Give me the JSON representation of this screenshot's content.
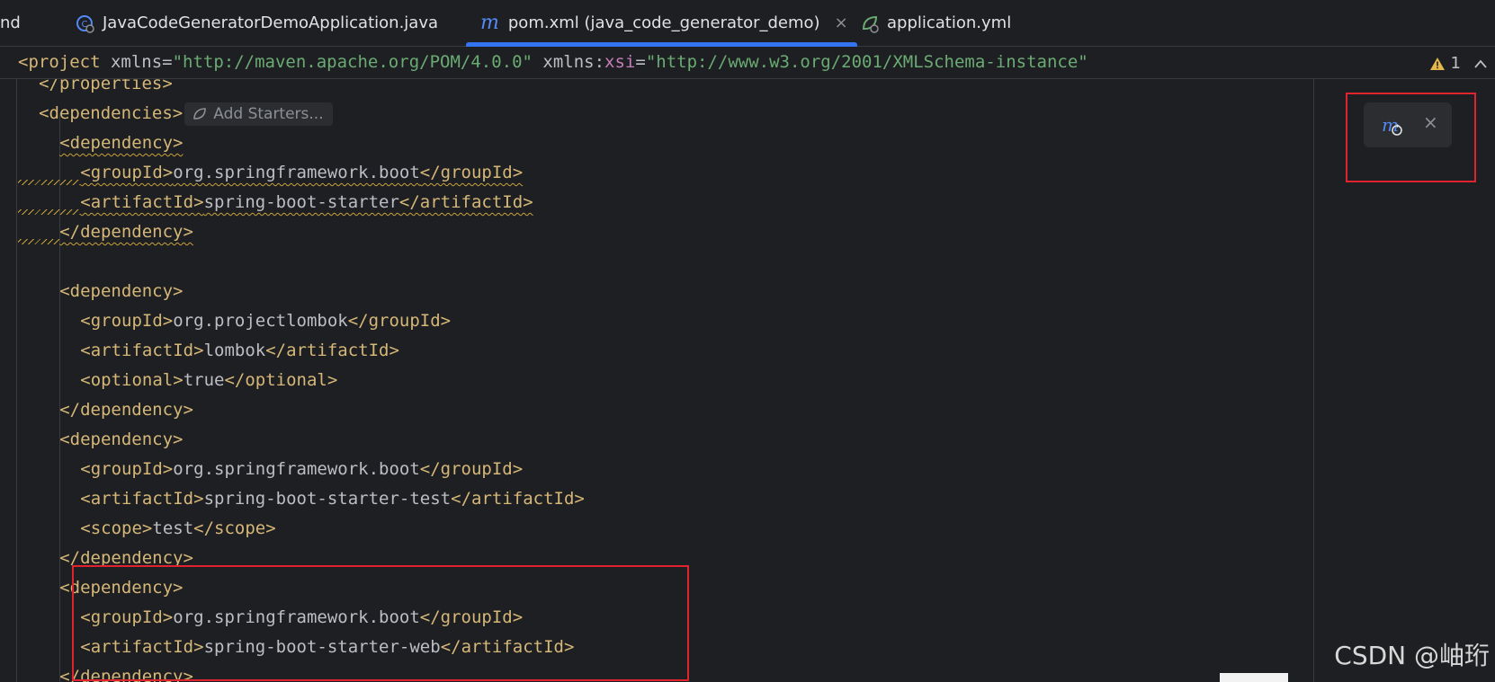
{
  "tabs": [
    {
      "label": "nd"
    },
    {
      "label": "JavaCodeGeneratorDemoApplication.java"
    },
    {
      "label": "pom.xml (java_code_generator_demo)",
      "icon": "m",
      "close": "×"
    },
    {
      "label": "application.yml"
    }
  ],
  "header": {
    "tag_open": "<project",
    "attr1": " xmlns=",
    "val1": "\"http://maven.apache.org/POM/4.0.0\"",
    "attr2_a": " xmlns:",
    "attr2_ns": "xsi",
    "attr2_eq": "=",
    "val2": "\"http://www.w3.org/2001/XMLSchema-instance\"",
    "warning_count": "1"
  },
  "starter_chip": "Add Starters...",
  "code_lines": [
    {
      "indent": 2,
      "tag1": "</properties>",
      "partial": true
    },
    {
      "indent": 2,
      "tag1": "<dependencies>",
      "chip": true
    },
    {
      "indent": 4,
      "tag1": "<dependency>",
      "squig": true
    },
    {
      "indent": 6,
      "tag1": "<groupId>",
      "text": "org.springframework.boot",
      "tag2": "</groupId>",
      "squig": true,
      "lead": true
    },
    {
      "indent": 6,
      "tag1": "<artifactId>",
      "text": "spring-boot-starter",
      "tag2": "</artifactId>",
      "squig": true,
      "lead": true
    },
    {
      "indent": 4,
      "tag1": "</dependency>",
      "squig": true,
      "lead": true
    },
    {
      "indent": 0,
      "tag1": ""
    },
    {
      "indent": 4,
      "tag1": "<dependency>"
    },
    {
      "indent": 6,
      "tag1": "<groupId>",
      "text": "org.projectlombok",
      "tag2": "</groupId>"
    },
    {
      "indent": 6,
      "tag1": "<artifactId>",
      "text": "lombok",
      "tag2": "</artifactId>"
    },
    {
      "indent": 6,
      "tag1": "<optional>",
      "text": "true",
      "tag2": "</optional>"
    },
    {
      "indent": 4,
      "tag1": "</dependency>"
    },
    {
      "indent": 4,
      "tag1": "<dependency>"
    },
    {
      "indent": 6,
      "tag1": "<groupId>",
      "text": "org.springframework.boot",
      "tag2": "</groupId>"
    },
    {
      "indent": 6,
      "tag1": "<artifactId>",
      "text": "spring-boot-starter-test",
      "tag2": "</artifactId>"
    },
    {
      "indent": 6,
      "tag1": "<scope>",
      "text": "test",
      "tag2": "</scope>"
    },
    {
      "indent": 4,
      "tag1": "</dependency>"
    },
    {
      "indent": 4,
      "tag1": "<dependency>"
    },
    {
      "indent": 6,
      "tag1": "<groupId>",
      "text": "org.springframework.boot",
      "tag2": "</groupId>"
    },
    {
      "indent": 6,
      "tag1": "<artifactId>",
      "text": "spring-boot-starter-web",
      "tag2": "</artifactId>"
    },
    {
      "indent": 4,
      "tag1": "</dependency>"
    }
  ],
  "maven_popup": {
    "icon": "maven-reload-icon",
    "close": "×"
  },
  "watermark": "CSDN @岫珩",
  "colors": {
    "tag": "#d5b778",
    "string": "#6aab73",
    "namespace": "#c77dbb",
    "accent": "#3574f0",
    "highlight": "#e0232e"
  }
}
